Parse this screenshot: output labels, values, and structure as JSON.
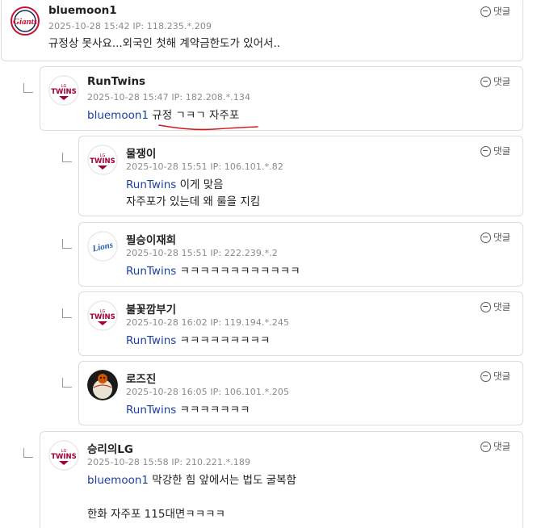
{
  "reply_label": "댓글",
  "comments": [
    {
      "nick": "bluemoon1",
      "meta": "2025-10-28 15:42 IP: 118.235.*.209",
      "mention": "",
      "lines": [
        "규정상 못사요...외국인 첫해 계약금한도가 있어서.."
      ],
      "avatar": "giants-logo"
    },
    {
      "nick": "RunTwins",
      "meta": "2025-10-28 15:47 IP: 182.208.*.134",
      "mention": "bluemoon1",
      "lines": [
        "규정 ㄱㅋㄱ 자주포"
      ],
      "avatar": "twins-logo"
    },
    {
      "nick": "물쟁이",
      "meta": "2025-10-28 15:51 IP: 106.101.*.82",
      "mention": "RunTwins",
      "lines": [
        "이게 맞음",
        "자주포가 있는데 왜 룰을 지킴"
      ],
      "avatar": "twins-logo"
    },
    {
      "nick": "필승이재희",
      "meta": "2025-10-28 15:51 IP: 222.239.*.2",
      "mention": "RunTwins",
      "lines": [
        "ㅋㅋㅋㅋㅋㅋㅋㅋㅋㅋㅋㅋ"
      ],
      "avatar": "lions-logo"
    },
    {
      "nick": "불꽃깜부기",
      "meta": "2025-10-28 16:02 IP: 119.194.*.245",
      "mention": "RunTwins",
      "lines": [
        "ㅋㅋㅋㅋㅋㅋㅋㅋㅋ"
      ],
      "avatar": "twins-logo"
    },
    {
      "nick": "로즈진",
      "meta": "2025-10-28 16:05 IP: 106.101.*.205",
      "mention": "RunTwins",
      "lines": [
        "ㅋㅋㅋㅋㅋㅋㅋ"
      ],
      "avatar": "ball-photo"
    },
    {
      "nick": "승리의LG",
      "meta": "2025-10-28 15:58 IP: 210.221.*.189",
      "mention": "bluemoon1",
      "lines": [
        "막강한 힘 앞에서는 법도 굴복함",
        "",
        "한화 자주포 115대면ㅋㅋㅋㅋ"
      ],
      "avatar": "twins-logo"
    }
  ]
}
